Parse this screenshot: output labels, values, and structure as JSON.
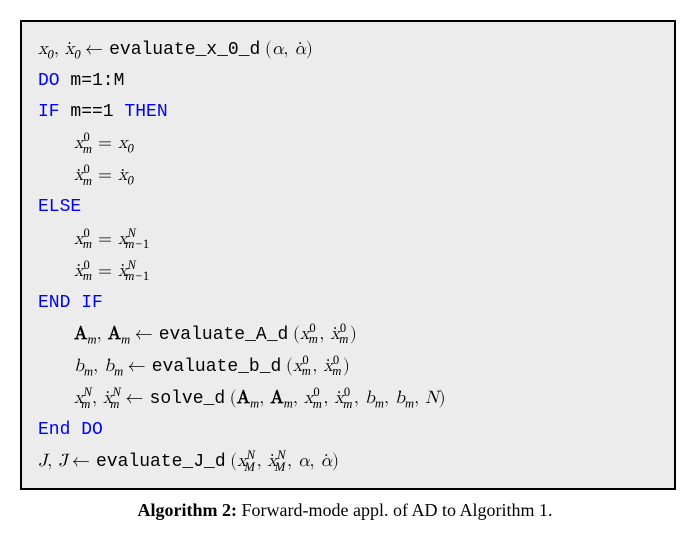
{
  "line1": {
    "func": "evaluate_x_0_d"
  },
  "line2": {
    "kw": "DO ",
    "rest": "m=1:M"
  },
  "line3": {
    "kw": "IF ",
    "cond": "m==1 ",
    "then": "THEN"
  },
  "line6": {
    "kw": "ELSE"
  },
  "line9": {
    "kw": "END IF"
  },
  "line10": {
    "func": "evaluate_A_d"
  },
  "line11": {
    "func": "evaluate_b_d"
  },
  "line12": {
    "func": "solve_d"
  },
  "line13": {
    "kw": "End DO"
  },
  "line14": {
    "func": "evaluate_J_d"
  },
  "caption": {
    "label": "Algorithm 2:",
    "text": " Forward-mode appl. of AD to Algorithm 1."
  }
}
